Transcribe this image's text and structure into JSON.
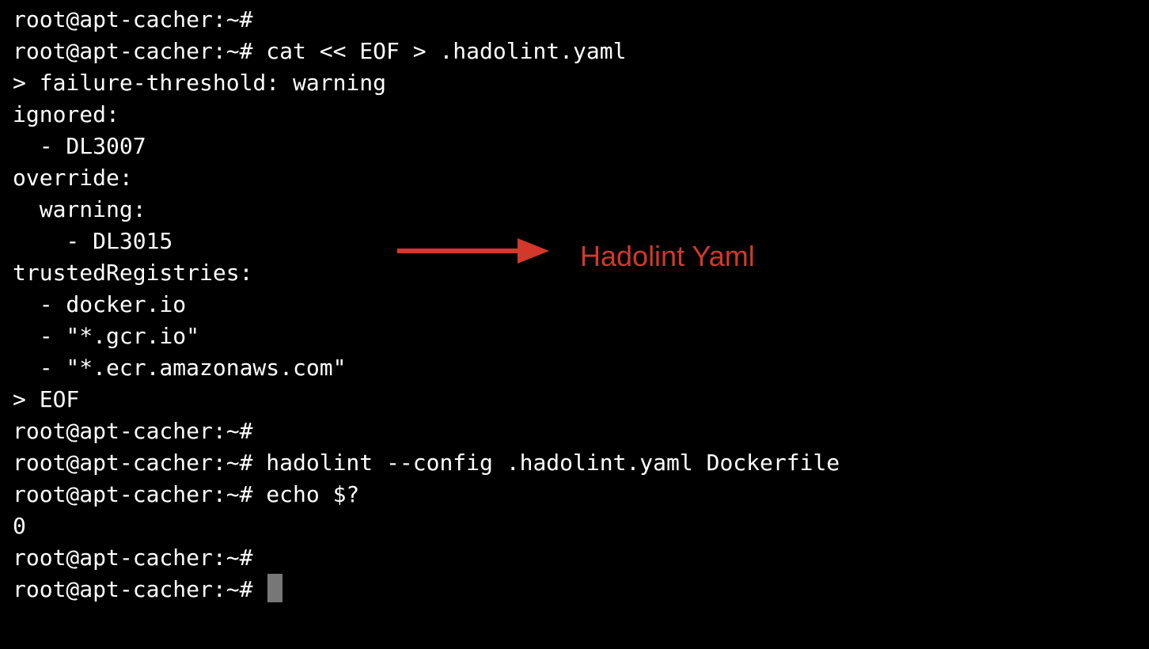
{
  "terminal": {
    "prompt": "root@apt-cacher:~#",
    "lines": [
      "root@apt-cacher:~#",
      "root@apt-cacher:~# cat << EOF > .hadolint.yaml",
      "> failure-threshold: warning",
      "ignored:",
      "  - DL3007",
      "override:",
      "  warning:",
      "    - DL3015",
      "trustedRegistries:",
      "  - docker.io",
      "  - \"*.gcr.io\"",
      "  - \"*.ecr.amazonaws.com\"",
      "> EOF",
      "root@apt-cacher:~#",
      "root@apt-cacher:~# hadolint --config .hadolint.yaml Dockerfile",
      "root@apt-cacher:~# echo $?",
      "0",
      "root@apt-cacher:~#"
    ],
    "current_prompt": "root@apt-cacher:~# "
  },
  "annotation": {
    "label": "Hadolint Yaml",
    "color": "#d2392b",
    "icon": "arrow-right-icon"
  },
  "colors": {
    "background": "#000000",
    "text": "#ffffff",
    "cursor": "#777777"
  }
}
